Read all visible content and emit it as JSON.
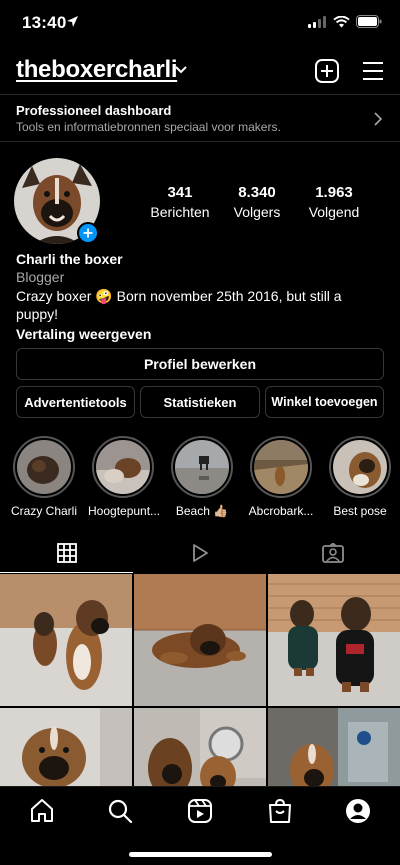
{
  "status": {
    "time": "13:40"
  },
  "header": {
    "username": "theboxercharli"
  },
  "dashboard": {
    "title": "Professioneel dashboard",
    "subtitle": "Tools en informatiebronnen speciaal voor makers."
  },
  "stats": [
    {
      "number": "341",
      "label": "Berichten"
    },
    {
      "number": "8.340",
      "label": "Volgers"
    },
    {
      "number": "1.963",
      "label": "Volgend"
    }
  ],
  "bio": {
    "name": "Charli the boxer",
    "category": "Blogger",
    "text": "Crazy boxer 🤪 Born november 25th 2016, but still a puppy!",
    "translate": "Vertaling weergeven"
  },
  "buttons": {
    "edit_profile": "Profiel bewerken",
    "ad_tools": "Advertentietools",
    "insights": "Statistieken",
    "add_shop": "Winkel toevoegen"
  },
  "highlights": [
    {
      "label": "Crazy Charli"
    },
    {
      "label": "Hoogtepunt..."
    },
    {
      "label": "Beach 👍🏼"
    },
    {
      "label": "Abcrobark..."
    },
    {
      "label": "Best pose"
    }
  ],
  "colors": {
    "accent": "#0095f6",
    "background": "#000000",
    "secondary_text": "#a8a8a8",
    "border": "#363636"
  },
  "icons": {
    "tab_grid": "grid-icon",
    "tab_reels": "play-icon",
    "tab_tagged": "tagged-person-icon",
    "nav": [
      "home-icon",
      "search-icon",
      "reels-icon",
      "shop-icon",
      "profile-icon"
    ]
  }
}
